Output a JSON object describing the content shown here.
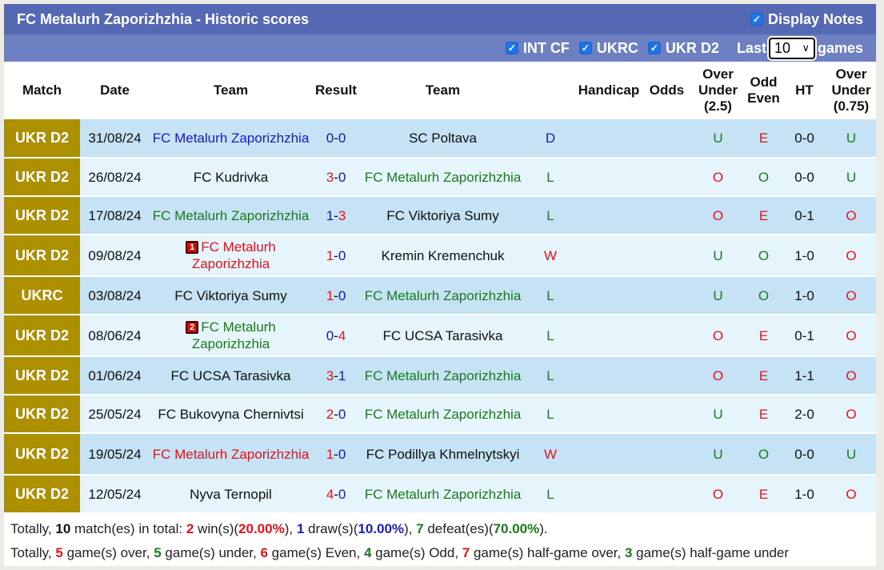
{
  "header": {
    "title": "FC Metalurh Zaporizhzhia - Historic scores",
    "display_notes_label": "Display Notes",
    "display_notes_checked": true
  },
  "filters": {
    "items": [
      {
        "label": "INT CF",
        "checked": true
      },
      {
        "label": "UKRC",
        "checked": true
      },
      {
        "label": "UKR D2",
        "checked": true
      }
    ],
    "last_label": "Last",
    "games_count": "10",
    "games_label": "games"
  },
  "columns": {
    "match": "Match",
    "date": "Date",
    "team1": "Team",
    "result": "Result",
    "team2": "Team",
    "handicap": "Handicap",
    "odds": "Odds",
    "ou_line1": "Over",
    "ou_line2": "Under",
    "ou_line3": "(2.5)",
    "oe_line1": "Odd",
    "oe_line2": "Even",
    "ht": "HT",
    "ou2_line1": "Over",
    "ou2_line2": "Under",
    "ou2_line3": "(0.75)"
  },
  "colors": {
    "title_bar": "#5468b4",
    "filter_bar": "#6f80c2",
    "league_badge": "#ad9000",
    "row_odd": "#c6e2f5",
    "row_even": "#e6f4fc",
    "red": "#e4131c",
    "green": "#1b7a1b",
    "blue": "#1a1acc"
  },
  "rows": [
    {
      "league": "UKR D2",
      "date": "31/08/24",
      "home": "FC Metalurh Zaporizhzhia",
      "home_color": "blue",
      "home_card": "",
      "score_home": "0",
      "score_away": "0",
      "sh_color": "blue",
      "sa_color": "blue",
      "away": "SC Poltava",
      "away_color": "dark",
      "outcome": "D",
      "outcome_color": "blue",
      "handicap": "",
      "odds": "",
      "ou": "U",
      "ou_color": "green",
      "oe": "E",
      "oe_color": "red",
      "ht": "0-0",
      "ou2": "U",
      "ou2_color": "green"
    },
    {
      "league": "UKR D2",
      "date": "26/08/24",
      "home": "FC Kudrivka",
      "home_color": "dark",
      "home_card": "",
      "score_home": "3",
      "score_away": "0",
      "sh_color": "red",
      "sa_color": "blue",
      "away": "FC Metalurh Zaporizhzhia",
      "away_color": "green",
      "outcome": "L",
      "outcome_color": "green",
      "handicap": "",
      "odds": "",
      "ou": "O",
      "ou_color": "red",
      "oe": "O",
      "oe_color": "green",
      "ht": "0-0",
      "ou2": "U",
      "ou2_color": "green"
    },
    {
      "league": "UKR D2",
      "date": "17/08/24",
      "home": "FC Metalurh Zaporizhzhia",
      "home_color": "green",
      "home_card": "",
      "score_home": "1",
      "score_away": "3",
      "sh_color": "blue",
      "sa_color": "red",
      "away": "FC Viktoriya Sumy",
      "away_color": "dark",
      "outcome": "L",
      "outcome_color": "green",
      "handicap": "",
      "odds": "",
      "ou": "O",
      "ou_color": "red",
      "oe": "E",
      "oe_color": "red",
      "ht": "0-1",
      "ou2": "O",
      "ou2_color": "red"
    },
    {
      "league": "UKR D2",
      "date": "09/08/24",
      "home": "FC Metalurh Zaporizhzhia",
      "home_color": "red",
      "home_card": "1",
      "score_home": "1",
      "score_away": "0",
      "sh_color": "red",
      "sa_color": "blue",
      "away": "Kremin Kremenchuk",
      "away_color": "dark",
      "outcome": "W",
      "outcome_color": "red",
      "handicap": "",
      "odds": "",
      "ou": "U",
      "ou_color": "green",
      "oe": "O",
      "oe_color": "green",
      "ht": "1-0",
      "ou2": "O",
      "ou2_color": "red"
    },
    {
      "league": "UKRC",
      "date": "03/08/24",
      "home": "FC Viktoriya Sumy",
      "home_color": "dark",
      "home_card": "",
      "score_home": "1",
      "score_away": "0",
      "sh_color": "red",
      "sa_color": "blue",
      "away": "FC Metalurh Zaporizhzhia",
      "away_color": "green",
      "outcome": "L",
      "outcome_color": "green",
      "handicap": "",
      "odds": "",
      "ou": "U",
      "ou_color": "green",
      "oe": "O",
      "oe_color": "green",
      "ht": "1-0",
      "ou2": "O",
      "ou2_color": "red"
    },
    {
      "league": "UKR D2",
      "date": "08/06/24",
      "home": "FC Metalurh Zaporizhzhia",
      "home_color": "green",
      "home_card": "2",
      "score_home": "0",
      "score_away": "4",
      "sh_color": "blue",
      "sa_color": "red",
      "away": "FC UCSA Tarasivka",
      "away_color": "dark",
      "outcome": "L",
      "outcome_color": "green",
      "handicap": "",
      "odds": "",
      "ou": "O",
      "ou_color": "red",
      "oe": "E",
      "oe_color": "red",
      "ht": "0-1",
      "ou2": "O",
      "ou2_color": "red"
    },
    {
      "league": "UKR D2",
      "date": "01/06/24",
      "home": "FC UCSA Tarasivka",
      "home_color": "dark",
      "home_card": "",
      "score_home": "3",
      "score_away": "1",
      "sh_color": "red",
      "sa_color": "blue",
      "away": "FC Metalurh Zaporizhzhia",
      "away_color": "green",
      "outcome": "L",
      "outcome_color": "green",
      "handicap": "",
      "odds": "",
      "ou": "O",
      "ou_color": "red",
      "oe": "E",
      "oe_color": "red",
      "ht": "1-1",
      "ou2": "O",
      "ou2_color": "red"
    },
    {
      "league": "UKR D2",
      "date": "25/05/24",
      "home": "FC Bukovyna Chernivtsi",
      "home_color": "dark",
      "home_card": "",
      "score_home": "2",
      "score_away": "0",
      "sh_color": "red",
      "sa_color": "blue",
      "away": "FC Metalurh Zaporizhzhia",
      "away_color": "green",
      "outcome": "L",
      "outcome_color": "green",
      "handicap": "",
      "odds": "",
      "ou": "U",
      "ou_color": "green",
      "oe": "E",
      "oe_color": "red",
      "ht": "2-0",
      "ou2": "O",
      "ou2_color": "red"
    },
    {
      "league": "UKR D2",
      "date": "19/05/24",
      "home": "FC Metalurh Zaporizhzhia",
      "home_color": "red",
      "home_card": "",
      "score_home": "1",
      "score_away": "0",
      "sh_color": "red",
      "sa_color": "blue",
      "away": "FC Podillya Khmelnytskyi",
      "away_color": "dark",
      "outcome": "W",
      "outcome_color": "red",
      "handicap": "",
      "odds": "",
      "ou": "U",
      "ou_color": "green",
      "oe": "O",
      "oe_color": "green",
      "ht": "0-0",
      "ou2": "U",
      "ou2_color": "green"
    },
    {
      "league": "UKR D2",
      "date": "12/05/24",
      "home": "Nyva Ternopil",
      "home_color": "dark",
      "home_card": "",
      "score_home": "4",
      "score_away": "0",
      "sh_color": "red",
      "sa_color": "blue",
      "away": "FC Metalurh Zaporizhzhia",
      "away_color": "green",
      "outcome": "L",
      "outcome_color": "green",
      "handicap": "",
      "odds": "",
      "ou": "O",
      "ou_color": "red",
      "oe": "E",
      "oe_color": "red",
      "ht": "1-0",
      "ou2": "O",
      "ou2_color": "red"
    }
  ],
  "summary": {
    "line1": [
      {
        "text": "Totally, ",
        "style": "plain"
      },
      {
        "text": "10",
        "style": "dark"
      },
      {
        "text": " match(es) in total: ",
        "style": "plain"
      },
      {
        "text": "2",
        "style": "red"
      },
      {
        "text": " win(s)(",
        "style": "plain"
      },
      {
        "text": "20.00%",
        "style": "red"
      },
      {
        "text": "), ",
        "style": "plain"
      },
      {
        "text": "1",
        "style": "blue"
      },
      {
        "text": " draw(s)(",
        "style": "plain"
      },
      {
        "text": "10.00%",
        "style": "blue"
      },
      {
        "text": "), ",
        "style": "plain"
      },
      {
        "text": "7",
        "style": "green"
      },
      {
        "text": " defeat(es)(",
        "style": "plain"
      },
      {
        "text": "70.00%",
        "style": "green"
      },
      {
        "text": ").",
        "style": "plain"
      }
    ],
    "line2": [
      {
        "text": "Totally, ",
        "style": "plain"
      },
      {
        "text": "5",
        "style": "red"
      },
      {
        "text": " game(s) over, ",
        "style": "plain"
      },
      {
        "text": "5",
        "style": "green"
      },
      {
        "text": " game(s) under, ",
        "style": "plain"
      },
      {
        "text": "6",
        "style": "red"
      },
      {
        "text": " game(s) Even, ",
        "style": "plain"
      },
      {
        "text": "4",
        "style": "green"
      },
      {
        "text": " game(s) Odd, ",
        "style": "plain"
      },
      {
        "text": "7",
        "style": "red"
      },
      {
        "text": " game(s) half-game over, ",
        "style": "plain"
      },
      {
        "text": "3",
        "style": "green"
      },
      {
        "text": " game(s) half-game under",
        "style": "plain"
      }
    ]
  }
}
